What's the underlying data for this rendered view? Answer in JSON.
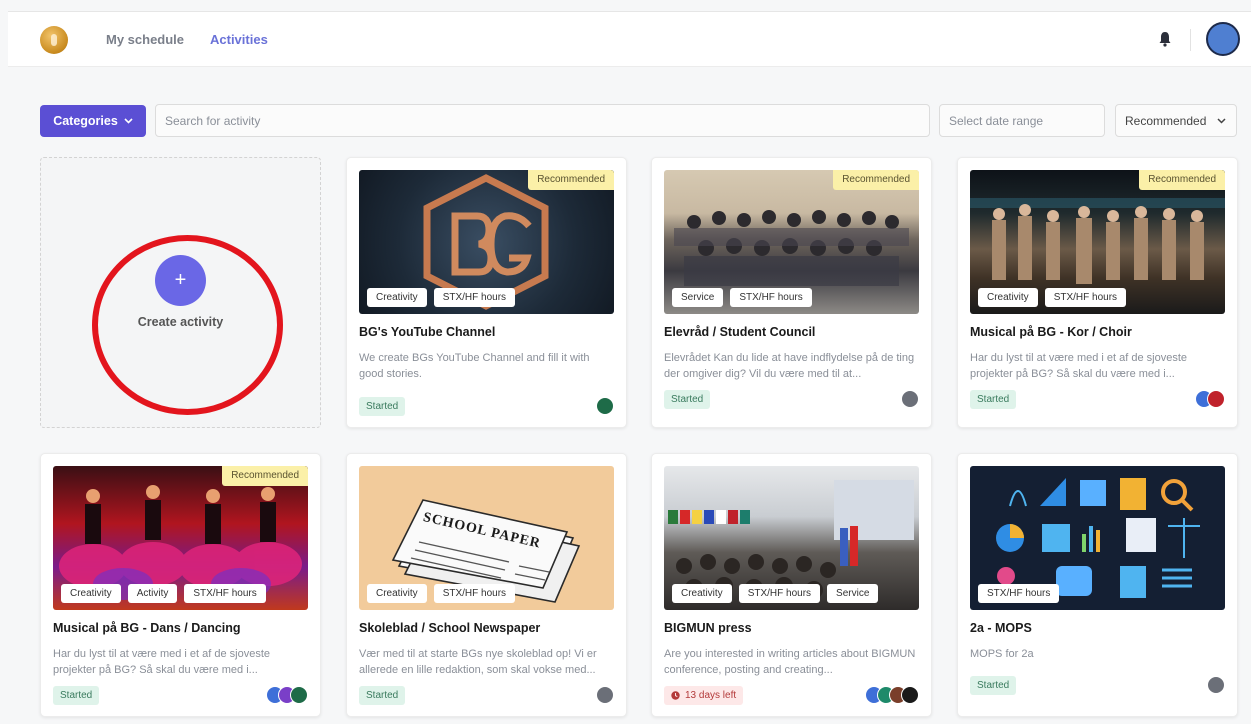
{
  "nav": {
    "schedule": "My schedule",
    "activities": "Activities"
  },
  "filters": {
    "categories_label": "Categories",
    "search_placeholder": "Search for activity",
    "date_placeholder": "Select date range",
    "sort_value": "Recommended"
  },
  "create": {
    "plus": "+",
    "label": "Create activity"
  },
  "badge_recommended": "Recommended",
  "cards": [
    {
      "title": "BG's YouTube Channel",
      "description": "We create BGs YouTube Channel and fill it with good stories.",
      "tags": [
        "Creativity",
        "STX/HF hours"
      ],
      "status": "Started",
      "recommended": true
    },
    {
      "title": "Elevråd / Student Council",
      "description": "Elevrådet Kan du lide at have indflydelse på de ting der omgiver dig? Vil du være med til at...",
      "tags": [
        "Service",
        "STX/HF hours"
      ],
      "status": "Started",
      "recommended": true
    },
    {
      "title": "Musical på BG - Kor / Choir",
      "description": "Har du lyst til at være med i et af de sjoveste projekter på BG? Så skal du være med i...",
      "tags": [
        "Creativity",
        "STX/HF hours"
      ],
      "status": "Started",
      "recommended": true
    },
    {
      "title": "Musical på BG - Dans / Dancing",
      "description": "Har du lyst til at være med i et af de sjoveste projekter på BG? Så skal du være med i...",
      "tags": [
        "Creativity",
        "Activity",
        "STX/HF hours"
      ],
      "status": "Started",
      "recommended": true
    },
    {
      "title": "Skoleblad / School Newspaper",
      "description": "Vær med til at starte BGs nye skoleblad op! Vi er allerede en lille redaktion, som skal vokse med...",
      "tags": [
        "Creativity",
        "STX/HF hours"
      ],
      "status": "Started",
      "recommended": false,
      "thumb_text": "SCHOOL PAPER"
    },
    {
      "title": "BIGMUN press",
      "description": "Are you interested in writing articles about BIGMUN conference, posting and creating...",
      "tags": [
        "Creativity",
        "STX/HF hours",
        "Service"
      ],
      "status": "13 days left",
      "recommended": false
    },
    {
      "title": "2a - MOPS",
      "description": "MOPS for 2a",
      "tags": [
        "STX/HF hours"
      ],
      "status": "Started",
      "recommended": false
    }
  ],
  "colors": {
    "accent": "#5b4fd4",
    "nav_active": "#6a72d8",
    "recommended_bg": "#fbf0a8",
    "status_started_bg": "#dff3ea",
    "status_warn_bg": "#fde8e8",
    "annotation_ring": "#e3151d"
  }
}
